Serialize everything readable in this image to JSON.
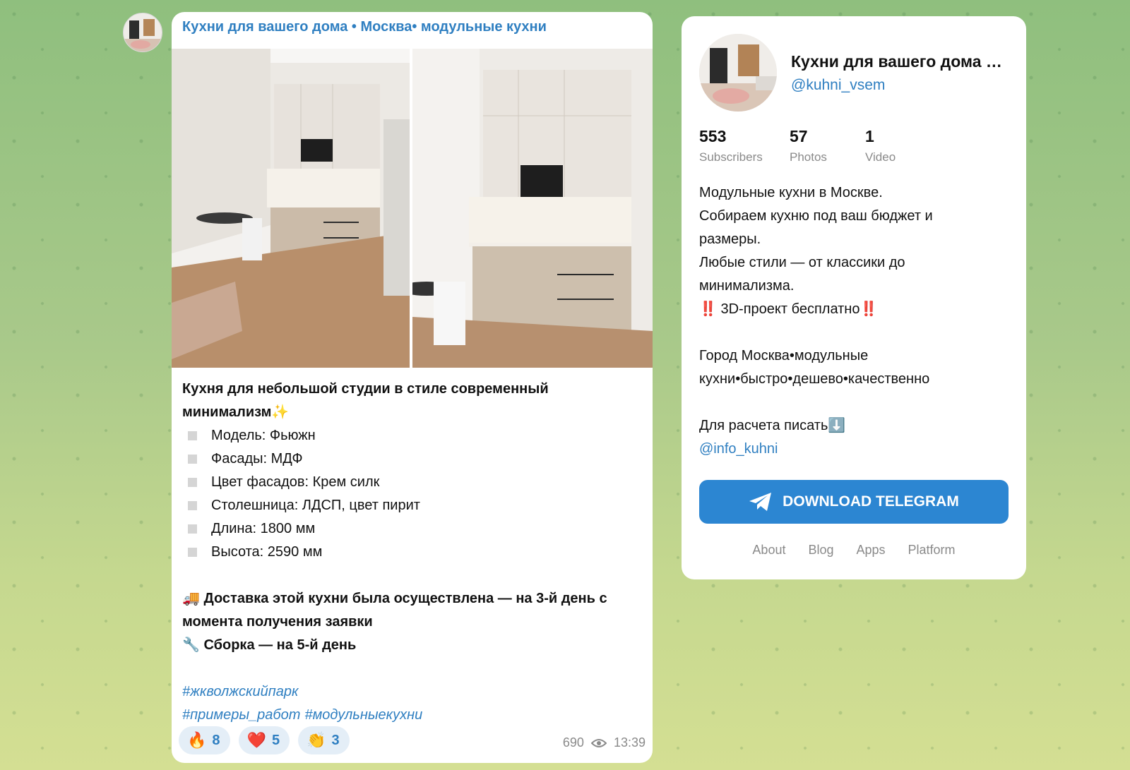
{
  "post": {
    "channel_name": "Кухни для вашего дома • Москва• модульные кухни",
    "title_line1": "Кухня для небольшой студии в стиле современный",
    "title_line2": "минимализм",
    "title_emoji": "✨",
    "specs": [
      "Модель: Фьюжн",
      "Фасады: МДФ",
      "Цвет фасадов: Крем силк",
      "Столешница: ЛДСП, цвет пирит",
      "Длина: 1800 мм",
      "Высота: 2590 мм"
    ],
    "delivery_emoji": "🚚",
    "delivery_line1": "Доставка этой кухни была осуществлена — на 3-й день с",
    "delivery_line2": "момента получения заявки",
    "assembly_emoji": "🔧",
    "assembly_text": "Сборка — на 5-й день",
    "hashtags": [
      "#жкволжскийпарк",
      "#примеры_работ",
      "#модульныекухни"
    ],
    "reactions": [
      {
        "emoji": "🔥",
        "count": "8"
      },
      {
        "emoji": "❤️",
        "count": "5"
      },
      {
        "emoji": "👏",
        "count": "3"
      }
    ],
    "views": "690",
    "time": "13:39"
  },
  "channel": {
    "title": "Кухни для вашего дома • Москва• модульные кухни",
    "handle": "@kuhni_vsem",
    "stats": [
      {
        "value": "553",
        "label": "Subscribers"
      },
      {
        "value": "57",
        "label": "Photos"
      },
      {
        "value": "1",
        "label": "Video"
      }
    ],
    "desc_lines": [
      "Модульные кухни в Москве.",
      "Собираем кухню под ваш бюджет и",
      "размеры.",
      "Любые стили — от классики до",
      "минимализма."
    ],
    "promo_mark": "‼️",
    "promo_text": "3D-проект бесплатно",
    "city_line1": "Город Москва•модульные",
    "city_line2": "кухни•быстро•дешево•качественно",
    "contact_text": "Для расчета писать",
    "contact_emoji": "⬇️",
    "contact_handle": "@info_kuhni",
    "download_label": "DOWNLOAD TELEGRAM",
    "footer_links": [
      "About",
      "Blog",
      "Apps",
      "Platform"
    ]
  },
  "colors": {
    "accent": "#2f7fc1",
    "button": "#2c86d2",
    "alert": "#e0262b"
  }
}
